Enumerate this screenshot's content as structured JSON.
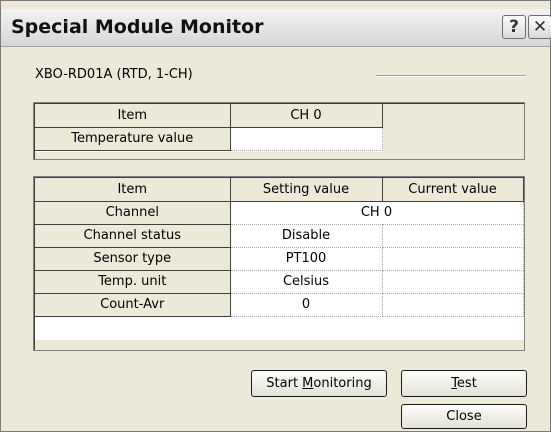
{
  "window": {
    "title": "Special Module Monitor",
    "help_label": "?",
    "close_label": "✕"
  },
  "module": {
    "label": "XBO-RD01A (RTD, 1-CH)"
  },
  "temperature_table": {
    "headers": [
      "Item",
      "CH 0"
    ],
    "rows": [
      {
        "item": "Temperature value",
        "value": ""
      }
    ]
  },
  "settings_table": {
    "headers": [
      "Item",
      "Setting value",
      "Current value"
    ],
    "channel_row": {
      "item": "Channel",
      "value": "CH 0"
    },
    "rows": [
      {
        "item": "Channel status",
        "setting": "Disable",
        "current": ""
      },
      {
        "item": "Sensor type",
        "setting": "PT100",
        "current": ""
      },
      {
        "item": "Temp. unit",
        "setting": "Celsius",
        "current": ""
      },
      {
        "item": "Count-Avr",
        "setting": "0",
        "current": ""
      }
    ]
  },
  "buttons": {
    "start_monitoring_prefix": "Start ",
    "start_monitoring_mnemonic": "M",
    "start_monitoring_suffix": "onitoring",
    "test_mnemonic": "T",
    "test_suffix": "est",
    "close": "Close"
  }
}
